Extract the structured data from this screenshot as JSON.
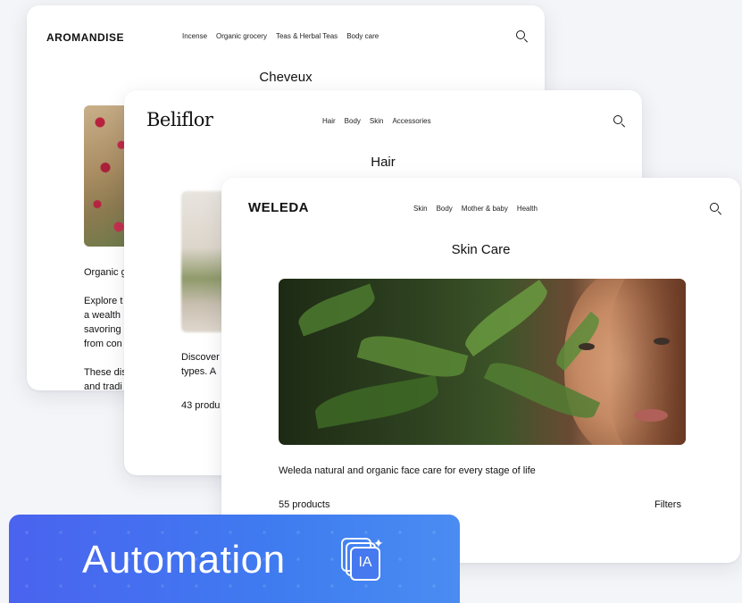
{
  "aromandise": {
    "logo": "AROMANDISE",
    "nav": [
      "Incense",
      "Organic grocery",
      "Teas & Herbal Teas",
      "Body care"
    ],
    "heading": "Cheveux",
    "text_lines": [
      "Organic g",
      "Explore t",
      "a wealth",
      "savoring",
      "from con",
      "These dis",
      "and tradi"
    ]
  },
  "beliflor": {
    "logo": "Beliflor",
    "nav": [
      "Hair",
      "Body",
      "Skin",
      "Accessories"
    ],
    "heading": "Hair",
    "text_lines": [
      "Discover",
      "types. A"
    ],
    "count": "43 produ"
  },
  "weleda": {
    "logo": "WELEDA",
    "nav": [
      "Skin",
      "Body",
      "Mother & baby",
      "Health"
    ],
    "heading": "Skin Care",
    "description": "Weleda natural and organic face care for every stage of life",
    "count": "55 products",
    "filters": "Filters"
  },
  "banner": {
    "label": "Automation",
    "icon_text": "IA"
  }
}
